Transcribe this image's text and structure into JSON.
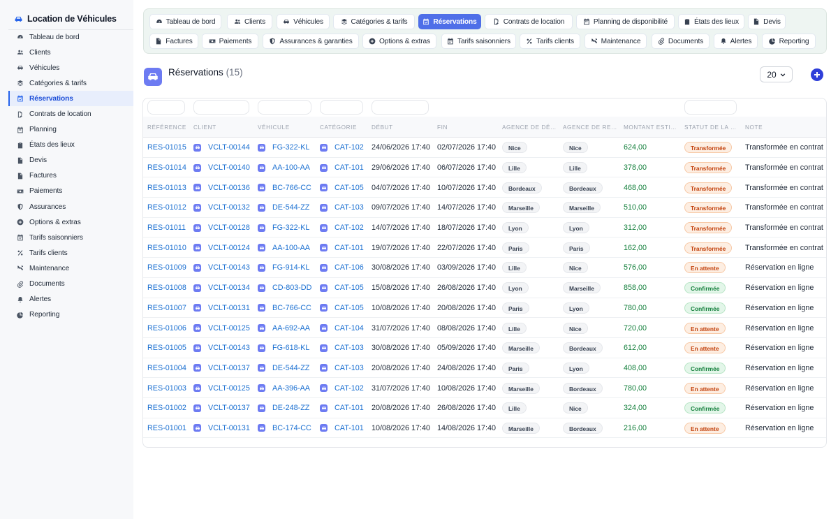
{
  "app": {
    "title": "Location de Véhicules"
  },
  "sidebar": {
    "items": [
      {
        "label": "Tableau de bord",
        "icon": "gauge-icon",
        "active": false
      },
      {
        "label": "Clients",
        "icon": "users-icon",
        "active": false
      },
      {
        "label": "Véhicules",
        "icon": "car-icon",
        "active": false
      },
      {
        "label": "Catégories & tarifs",
        "icon": "layers-icon",
        "active": false
      },
      {
        "label": "Réservations",
        "icon": "calendar-check-icon",
        "active": true
      },
      {
        "label": "Contrats de location",
        "icon": "file-signature-icon",
        "active": false
      },
      {
        "label": "Planning",
        "icon": "calendar-icon",
        "active": false
      },
      {
        "label": "États des lieux",
        "icon": "clipboard-icon",
        "active": false
      },
      {
        "label": "Devis",
        "icon": "file-icon",
        "active": false
      },
      {
        "label": "Factures",
        "icon": "invoice-icon",
        "active": false
      },
      {
        "label": "Paiements",
        "icon": "money-icon",
        "active": false
      },
      {
        "label": "Assurances",
        "icon": "shield-icon",
        "active": false
      },
      {
        "label": "Options & extras",
        "icon": "plus-circle-icon",
        "active": false
      },
      {
        "label": "Tarifs saisonniers",
        "icon": "calendar-alt-icon",
        "active": false
      },
      {
        "label": "Tarifs clients",
        "icon": "percent-icon",
        "active": false
      },
      {
        "label": "Maintenance",
        "icon": "tools-icon",
        "active": false
      },
      {
        "label": "Documents",
        "icon": "paperclip-icon",
        "active": false
      },
      {
        "label": "Alertes",
        "icon": "bell-icon",
        "active": false
      },
      {
        "label": "Reporting",
        "icon": "pie-chart-icon",
        "active": false
      }
    ]
  },
  "tabs": [
    {
      "label": "Tableau de bord",
      "icon": "gauge-icon",
      "active": false
    },
    {
      "label": "Clients",
      "icon": "users-icon",
      "active": false
    },
    {
      "label": "Véhicules",
      "icon": "car-icon",
      "active": false
    },
    {
      "label": "Catégories & tarifs",
      "icon": "layers-icon",
      "active": false
    },
    {
      "label": "Réservations",
      "icon": "calendar-check-icon",
      "active": true
    },
    {
      "label": "Contrats de location",
      "icon": "file-signature-icon",
      "active": false
    },
    {
      "label": "Planning de disponibilité",
      "icon": "calendar-icon",
      "active": false
    },
    {
      "label": "États des lieux",
      "icon": "clipboard-icon",
      "active": false
    },
    {
      "label": "Devis",
      "icon": "file-icon",
      "active": false
    },
    {
      "label": "Factures",
      "icon": "invoice-icon",
      "active": false
    },
    {
      "label": "Paiements",
      "icon": "money-icon",
      "active": false
    },
    {
      "label": "Assurances & garanties",
      "icon": "shield-icon",
      "active": false
    },
    {
      "label": "Options & extras",
      "icon": "plus-circle-icon",
      "active": false
    },
    {
      "label": "Tarifs saisonniers",
      "icon": "calendar-alt-icon",
      "active": false
    },
    {
      "label": "Tarifs clients",
      "icon": "percent-icon",
      "active": false
    },
    {
      "label": "Maintenance",
      "icon": "tools-icon",
      "active": false
    },
    {
      "label": "Documents",
      "icon": "paperclip-icon",
      "active": false
    },
    {
      "label": "Alertes",
      "icon": "bell-icon",
      "active": false
    },
    {
      "label": "Reporting",
      "icon": "pie-chart-icon",
      "active": false
    }
  ],
  "section": {
    "title": "Réservations",
    "count": "(15)",
    "page_size": "20",
    "icon": "car-icon"
  },
  "colors": {
    "accent": "#4f6fe8",
    "link": "#1a6fd1",
    "amount": "#15803d",
    "section_icon": "#6d7bf2"
  },
  "table": {
    "columns": [
      "Référence",
      "Client",
      "Véhicule",
      "Catégorie",
      "Début",
      "Fin",
      "Agence de dé…",
      "Agence de re…",
      "Montant esti…",
      "Statut de la …",
      "Note"
    ],
    "rows": [
      {
        "ref": "RES-01015",
        "client": "VCLT-00144",
        "vehicle": "FG-322-KL",
        "category": "CAT-102",
        "start": "24/06/2026 17:40",
        "end": "02/07/2026 17:40",
        "agency_dep": "Nice",
        "agency_ret": "Nice",
        "amount": "624,00",
        "status": "Transformée",
        "status_kind": "transformee",
        "note": "Transformée en contrat"
      },
      {
        "ref": "RES-01014",
        "client": "VCLT-00140",
        "vehicle": "AA-100-AA",
        "category": "CAT-101",
        "start": "29/06/2026 17:40",
        "end": "06/07/2026 17:40",
        "agency_dep": "Lille",
        "agency_ret": "Lille",
        "amount": "378,00",
        "status": "Transformée",
        "status_kind": "transformee",
        "note": "Transformée en contrat"
      },
      {
        "ref": "RES-01013",
        "client": "VCLT-00136",
        "vehicle": "BC-766-CC",
        "category": "CAT-105",
        "start": "04/07/2026 17:40",
        "end": "10/07/2026 17:40",
        "agency_dep": "Bordeaux",
        "agency_ret": "Bordeaux",
        "amount": "468,00",
        "status": "Transformée",
        "status_kind": "transformee",
        "note": "Transformée en contrat"
      },
      {
        "ref": "RES-01012",
        "client": "VCLT-00132",
        "vehicle": "DE-544-ZZ",
        "category": "CAT-103",
        "start": "09/07/2026 17:40",
        "end": "14/07/2026 17:40",
        "agency_dep": "Marseille",
        "agency_ret": "Marseille",
        "amount": "510,00",
        "status": "Transformée",
        "status_kind": "transformee",
        "note": "Transformée en contrat"
      },
      {
        "ref": "RES-01011",
        "client": "VCLT-00128",
        "vehicle": "FG-322-KL",
        "category": "CAT-102",
        "start": "14/07/2026 17:40",
        "end": "18/07/2026 17:40",
        "agency_dep": "Lyon",
        "agency_ret": "Lyon",
        "amount": "312,00",
        "status": "Transformée",
        "status_kind": "transformee",
        "note": "Transformée en contrat"
      },
      {
        "ref": "RES-01010",
        "client": "VCLT-00124",
        "vehicle": "AA-100-AA",
        "category": "CAT-101",
        "start": "19/07/2026 17:40",
        "end": "22/07/2026 17:40",
        "agency_dep": "Paris",
        "agency_ret": "Paris",
        "amount": "162,00",
        "status": "Transformée",
        "status_kind": "transformee",
        "note": "Transformée en contrat"
      },
      {
        "ref": "RES-01009",
        "client": "VCLT-00143",
        "vehicle": "FG-914-KL",
        "category": "CAT-106",
        "start": "30/08/2026 17:40",
        "end": "03/09/2026 17:40",
        "agency_dep": "Lille",
        "agency_ret": "Nice",
        "amount": "576,00",
        "status": "En attente",
        "status_kind": "attente",
        "note": "Réservation en ligne"
      },
      {
        "ref": "RES-01008",
        "client": "VCLT-00134",
        "vehicle": "CD-803-DD",
        "category": "CAT-105",
        "start": "15/08/2026 17:40",
        "end": "26/08/2026 17:40",
        "agency_dep": "Lyon",
        "agency_ret": "Marseille",
        "amount": "858,00",
        "status": "Confirmée",
        "status_kind": "confirmee",
        "note": "Réservation en ligne"
      },
      {
        "ref": "RES-01007",
        "client": "VCLT-00131",
        "vehicle": "BC-766-CC",
        "category": "CAT-105",
        "start": "10/08/2026 17:40",
        "end": "20/08/2026 17:40",
        "agency_dep": "Paris",
        "agency_ret": "Lyon",
        "amount": "780,00",
        "status": "Confirmée",
        "status_kind": "confirmee",
        "note": "Réservation en ligne"
      },
      {
        "ref": "RES-01006",
        "client": "VCLT-00125",
        "vehicle": "AA-692-AA",
        "category": "CAT-104",
        "start": "31/07/2026 17:40",
        "end": "08/08/2026 17:40",
        "agency_dep": "Lille",
        "agency_ret": "Nice",
        "amount": "720,00",
        "status": "En attente",
        "status_kind": "attente",
        "note": "Réservation en ligne"
      },
      {
        "ref": "RES-01005",
        "client": "VCLT-00143",
        "vehicle": "FG-618-KL",
        "category": "CAT-103",
        "start": "30/08/2026 17:40",
        "end": "05/09/2026 17:40",
        "agency_dep": "Marseille",
        "agency_ret": "Bordeaux",
        "amount": "612,00",
        "status": "En attente",
        "status_kind": "attente",
        "note": "Réservation en ligne"
      },
      {
        "ref": "RES-01004",
        "client": "VCLT-00137",
        "vehicle": "DE-544-ZZ",
        "category": "CAT-103",
        "start": "20/08/2026 17:40",
        "end": "24/08/2026 17:40",
        "agency_dep": "Paris",
        "agency_ret": "Lyon",
        "amount": "408,00",
        "status": "Confirmée",
        "status_kind": "confirmee",
        "note": "Réservation en ligne"
      },
      {
        "ref": "RES-01003",
        "client": "VCLT-00125",
        "vehicle": "AA-396-AA",
        "category": "CAT-102",
        "start": "31/07/2026 17:40",
        "end": "10/08/2026 17:40",
        "agency_dep": "Marseille",
        "agency_ret": "Bordeaux",
        "amount": "780,00",
        "status": "En attente",
        "status_kind": "attente",
        "note": "Réservation en ligne"
      },
      {
        "ref": "RES-01002",
        "client": "VCLT-00137",
        "vehicle": "DE-248-ZZ",
        "category": "CAT-101",
        "start": "20/08/2026 17:40",
        "end": "26/08/2026 17:40",
        "agency_dep": "Lille",
        "agency_ret": "Nice",
        "amount": "324,00",
        "status": "Confirmée",
        "status_kind": "confirmee",
        "note": "Réservation en ligne"
      },
      {
        "ref": "RES-01001",
        "client": "VCLT-00131",
        "vehicle": "BC-174-CC",
        "category": "CAT-101",
        "start": "10/08/2026 17:40",
        "end": "14/08/2026 17:40",
        "agency_dep": "Marseille",
        "agency_ret": "Bordeaux",
        "amount": "216,00",
        "status": "En attente",
        "status_kind": "attente",
        "note": "Réservation en ligne"
      }
    ]
  }
}
